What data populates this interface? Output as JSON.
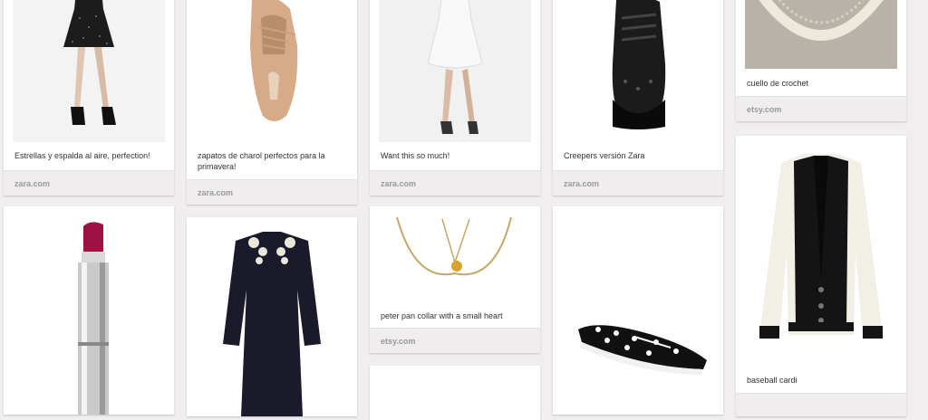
{
  "pins": [
    {
      "image": "black polka dot backless dress",
      "caption": "Estrellas y espalda al aire, perfection!",
      "source": "zara.com"
    },
    {
      "image": "nude patent lace-up shoe",
      "caption": "zapatos de charol perfectos para la primavera!",
      "source": "zara.com"
    },
    {
      "image": "white lace dress",
      "caption": "Want this so much!",
      "source": "zara.com"
    },
    {
      "image": "black creeper shoe",
      "caption": "Creepers versión Zara",
      "source": "zara.com"
    },
    {
      "image": "crochet collar",
      "caption": "cuello de crochet",
      "source": "etsy.com"
    },
    {
      "image": "red lipstick",
      "caption": "",
      "source": ""
    },
    {
      "image": "black dress with lace collar",
      "caption": "",
      "source": ""
    },
    {
      "image": "gold heart necklace",
      "caption": "peter pan collar with a small heart",
      "source": "etsy.com"
    },
    {
      "image": "polka dot boat shoe",
      "caption": "",
      "source": ""
    },
    {
      "image": "baseball cardigan",
      "caption": "baseball cardi",
      "source": ""
    }
  ]
}
